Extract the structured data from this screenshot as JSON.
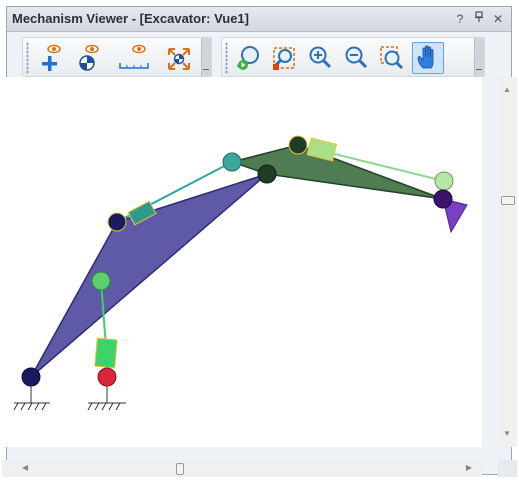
{
  "window": {
    "title": "Mechanism Viewer - [Excavator: Vue1]",
    "help_glyph": "?",
    "pin_glyph": "չ",
    "close_glyph": "✕"
  },
  "toolbar": {
    "group1": [
      {
        "name": "add-point-icon"
      },
      {
        "name": "center-of-mass-icon"
      },
      {
        "name": "measure-icon"
      },
      {
        "name": "fit-extents-icon"
      }
    ],
    "group2": [
      {
        "name": "zoom-reset-icon"
      },
      {
        "name": "zoom-window-icon"
      },
      {
        "name": "zoom-in-icon"
      },
      {
        "name": "zoom-out-icon"
      },
      {
        "name": "zoom-area-icon"
      },
      {
        "name": "pan-hand-icon",
        "active": true
      }
    ]
  },
  "colors": {
    "boom": "#5f5aa8",
    "stick": "#4f7c50",
    "bucket": "#7a40c4",
    "link_cyan": "#2ba4a4",
    "link_light_green": "#8fd88f",
    "node_navy": "#1a1a5e",
    "node_red": "#d8263a",
    "node_green": "#5ecf6e",
    "node_teal": "#3aa79b",
    "node_dark_green": "#1e3c27",
    "node_purple": "#3d126c",
    "node_pale_green": "#b6e6a8",
    "actuator_teal": "#2d9a8a",
    "actuator_green": "#3bd36a",
    "actuator_pale": "#a8e088",
    "highlight": "#f0c040",
    "accent": "#3a76c4"
  },
  "scroll": {
    "up_arrow": "▲",
    "down_arrow": "▼",
    "left_arrow": "◀",
    "right_arrow": "▶"
  }
}
